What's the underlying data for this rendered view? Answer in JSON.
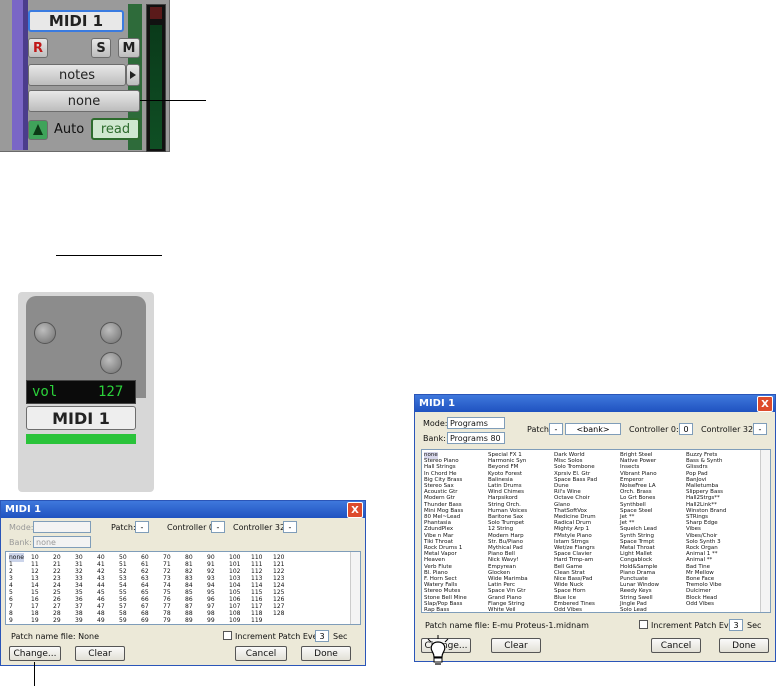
{
  "mix_strip": {
    "track_name": "MIDI 1",
    "record_label": "R",
    "solo_label": "S",
    "mute_label": "M",
    "input_selector": "notes",
    "patch_selector": "none",
    "automation_label": "Auto",
    "automation_mode": "read"
  },
  "edit_strip": {
    "volume_label": "vol",
    "volume_value": "127",
    "track_name": "MIDI 1"
  },
  "dialog_programs": {
    "title": "MIDI 1",
    "close": "X",
    "mode_label": "Mode:",
    "mode_value": "Programs",
    "bank_label": "Bank:",
    "bank_value": "Programs 80",
    "patch_label": "Patch:",
    "patch_value": "-",
    "patch_name_value": "<bank>",
    "controller0_label": "Controller 0:",
    "controller0_value": "0",
    "controller32_label": "Controller 32:",
    "controller32_value": "-",
    "patch_file_label": "Patch name file: E-mu Proteus-1.midnam",
    "increment_label": "Increment Patch Every",
    "increment_value": "3",
    "sec_label": "Sec",
    "change_label": "Change...",
    "clear_label": "Clear",
    "cancel_label": "Cancel",
    "done_label": "Done",
    "columns": [
      [
        "none",
        "Stereo Piano",
        "Hall Strings",
        "In Chord He",
        "Big City Brass",
        "Stereo Sax",
        "Acoustic Gtr",
        "Modern Gtr",
        "Thunder Bass",
        "Mini Mog Bass",
        "80 Mel~Lead",
        "Phantasia",
        "ZdundPlex",
        "Vibe n Mar",
        "Tiki Throat",
        "Rock Drums 1",
        "Metal Vapor",
        "Heaven",
        "Verb Flute",
        "Bl. Piano",
        "F. Horn Sect",
        "Watery Falls",
        "Stereo Mutes",
        "Stone Bell Mine",
        "Slap/Pop Bass",
        "Rap Bass"
      ],
      [
        "Special FX 1",
        "Harmonic Syn",
        "Beyond FM",
        "Kyoto Forest",
        "Balinesia",
        "Latin Drums",
        "Wind Chimes",
        "Harpsikord",
        "String Orch.",
        "Human Voices",
        "Baritone Sax",
        "Solo Trumpet",
        "12 String",
        "Modern Harp",
        "Str. Bu/Piano",
        "Mythical Pad",
        "Piano Bell",
        "Nick Wavy!",
        "Empyrean",
        "Glocken",
        "Wide Marimba",
        "Latin Perc",
        "Space Vin Gtr",
        "Grand Piano",
        "Flange String",
        "White Veil"
      ],
      [
        "Dark World",
        "Misc Solos",
        "Solo Trombone",
        "Xprsiv El. Gtr",
        "Space Bass Pad",
        "Dune",
        "Ril's Wine",
        "Octave Choir",
        "Glano",
        "ThatSoftVox",
        "Medicine Drum",
        "Radical Drum",
        "Mighty Arp 1",
        "FMstyle Piano",
        "Istam Strngs",
        "Wet/ze Flangrs",
        "Space Clavier",
        "Hard Trmp-am",
        "Bell Game",
        "Clean Strat",
        "Nice Bass/Pad",
        "Wide Nuck",
        "Space Horn",
        "Blue Ice",
        "Embered Tines",
        "Odd Vibes"
      ],
      [
        "Bright Steel",
        "Native Power",
        "Insects",
        "Vibrant Piano",
        "Emperor",
        "NoiseFree LA",
        "Orch. Brass",
        "Lo Grt Bones",
        "Synthbell",
        "Space Steel",
        "Jet **",
        "Jet **",
        "Squelch Lead",
        "Synth String",
        "Space Trmpt",
        "Metal Throat",
        "Light Mallet",
        "Congablock",
        "Hold&Sample",
        "Piano Drama",
        "Punctuate",
        "Lunar Window",
        "Reedy Keys",
        "String Swell",
        "Jingle Pad",
        "Solo Lead"
      ],
      [
        "Buzzy Frets",
        "Bass & Synth",
        "Glissdrs",
        "Pop Pad",
        "BanJovi",
        "Malletumba",
        "Slippery Bass",
        "Hall2Strgs**",
        "Hall2Link**",
        "Winston Brand",
        "STRings",
        "Sharp Edge",
        "Vibes",
        "Vibes/Choir",
        "Solo Synth 3",
        "Rock Organ",
        "Animal 1 **",
        "Animal **",
        "Bad Tine",
        "Mr Mellow",
        "Bone Face",
        "Tremolo Vibe",
        "Dulcimer",
        "Block Head",
        "Odd Vibes",
        ""
      ]
    ]
  },
  "dialog_none": {
    "title": "MIDI 1",
    "close": "X",
    "mode_label": "Mode:",
    "bank_label": "Bank:",
    "bank_value": "none",
    "patch_label": "Patch:",
    "patch_value": "-",
    "controller0_label": "Controller 0:",
    "controller0_value": "-",
    "controller32_label": "Controller 32:",
    "controller32_value": "-",
    "patch_file_label": "Patch name file: None",
    "increment_label": "Increment Patch Every",
    "increment_value": "3",
    "sec_label": "Sec",
    "change_label": "Change...",
    "clear_label": "Clear",
    "cancel_label": "Cancel",
    "done_label": "Done",
    "rows": [
      [
        "none",
        "10",
        "20",
        "30",
        "40",
        "50",
        "60",
        "70",
        "80",
        "90",
        "100",
        "110",
        "120"
      ],
      [
        "1",
        "11",
        "21",
        "31",
        "41",
        "51",
        "61",
        "71",
        "81",
        "91",
        "101",
        "111",
        "121"
      ],
      [
        "2",
        "12",
        "22",
        "32",
        "42",
        "52",
        "62",
        "72",
        "82",
        "92",
        "102",
        "112",
        "122"
      ],
      [
        "3",
        "13",
        "23",
        "33",
        "43",
        "53",
        "63",
        "73",
        "83",
        "93",
        "103",
        "113",
        "123"
      ],
      [
        "4",
        "14",
        "24",
        "34",
        "44",
        "54",
        "64",
        "74",
        "84",
        "94",
        "104",
        "114",
        "124"
      ],
      [
        "5",
        "15",
        "25",
        "35",
        "45",
        "55",
        "65",
        "75",
        "85",
        "95",
        "105",
        "115",
        "125"
      ],
      [
        "6",
        "16",
        "26",
        "36",
        "46",
        "56",
        "66",
        "76",
        "86",
        "96",
        "106",
        "116",
        "126"
      ],
      [
        "7",
        "17",
        "27",
        "37",
        "47",
        "57",
        "67",
        "77",
        "87",
        "97",
        "107",
        "117",
        "127"
      ],
      [
        "8",
        "18",
        "28",
        "38",
        "48",
        "58",
        "68",
        "78",
        "88",
        "98",
        "108",
        "118",
        "128"
      ],
      [
        "9",
        "19",
        "29",
        "39",
        "49",
        "59",
        "69",
        "79",
        "89",
        "99",
        "109",
        "119",
        ""
      ]
    ]
  },
  "icons": {
    "bulb": "lightbulb-icon"
  }
}
